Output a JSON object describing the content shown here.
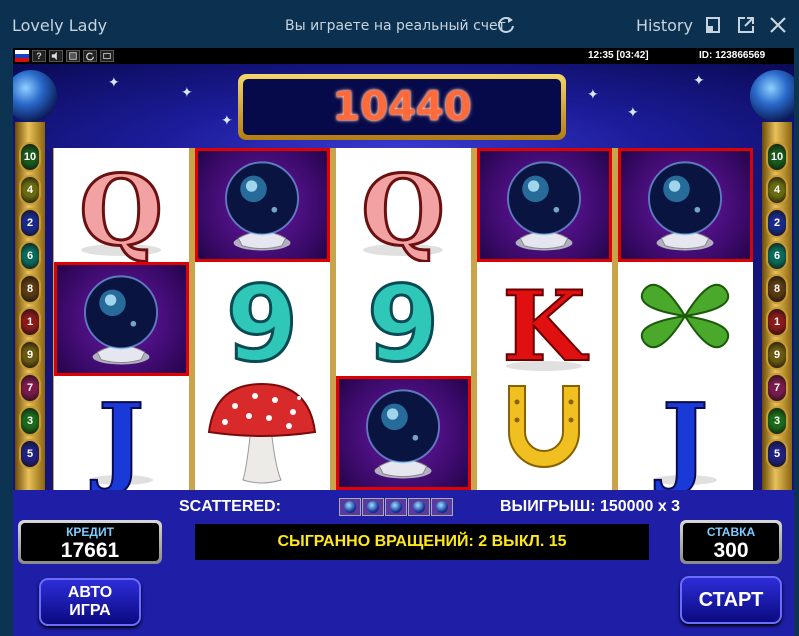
{
  "window": {
    "app_title": "Lovely Lady",
    "real_account_note": "Вы играете на реальный счет",
    "history_label": "History"
  },
  "status_bar": {
    "language_flag": "russian-flag",
    "help_label": "?",
    "clock": "12:35 [03:42]",
    "player_id": "ID: 123866569"
  },
  "win_display": {
    "value": "10440"
  },
  "paylines_left": [
    "10",
    "4",
    "2",
    "6",
    "8",
    "1",
    "9",
    "7",
    "3",
    "5"
  ],
  "paylines_right": [
    "10",
    "4",
    "2",
    "6",
    "8",
    "1",
    "9",
    "7",
    "3",
    "5"
  ],
  "payline_colors": {
    "1": "#8a1a1a",
    "2": "#1a2a8a",
    "3": "#1a6a1a",
    "4": "#6a6a10",
    "5": "#202080",
    "6": "#0a6a5a",
    "7": "#7a1a4a",
    "8": "#5a3a10",
    "9": "#6a5a10",
    "10": "#1a5a1a"
  },
  "reels": [
    [
      {
        "symbol": "Q",
        "highlight": false
      },
      {
        "symbol": "crystal-ball",
        "highlight": true
      },
      {
        "symbol": "J",
        "highlight": false
      }
    ],
    [
      {
        "symbol": "crystal-ball",
        "highlight": true
      },
      {
        "symbol": "9",
        "highlight": false
      },
      {
        "symbol": "mushroom",
        "highlight": false
      }
    ],
    [
      {
        "symbol": "Q",
        "highlight": false
      },
      {
        "symbol": "9",
        "highlight": false
      },
      {
        "symbol": "crystal-ball",
        "highlight": true
      }
    ],
    [
      {
        "symbol": "crystal-ball",
        "highlight": true
      },
      {
        "symbol": "K",
        "highlight": false
      },
      {
        "symbol": "horseshoe",
        "highlight": false
      }
    ],
    [
      {
        "symbol": "crystal-ball",
        "highlight": true
      },
      {
        "symbol": "clover",
        "highlight": false
      },
      {
        "symbol": "J",
        "highlight": false
      }
    ]
  ],
  "bottom": {
    "scattered_label": "SCATTERED:",
    "scatter_count": 5,
    "win_line": "ВЫИГРЫШ: 150000 x 3",
    "credit_label": "КРЕДИТ",
    "credit_value": "17661",
    "message": "СЫГРАННО ВРАЩЕНИЙ: 2 ВЫКЛ. 15",
    "bet_label": "СТАВКА",
    "bet_value": "300",
    "autoplay_line1": "АВТО",
    "autoplay_line2": "ИГРА",
    "start_label": "СТАРТ"
  },
  "colors": {
    "win_value": "#ff6a3a",
    "message_text": "#ffe81a",
    "highlight_border": "#e00000",
    "panel_label": "#7ecbff"
  }
}
